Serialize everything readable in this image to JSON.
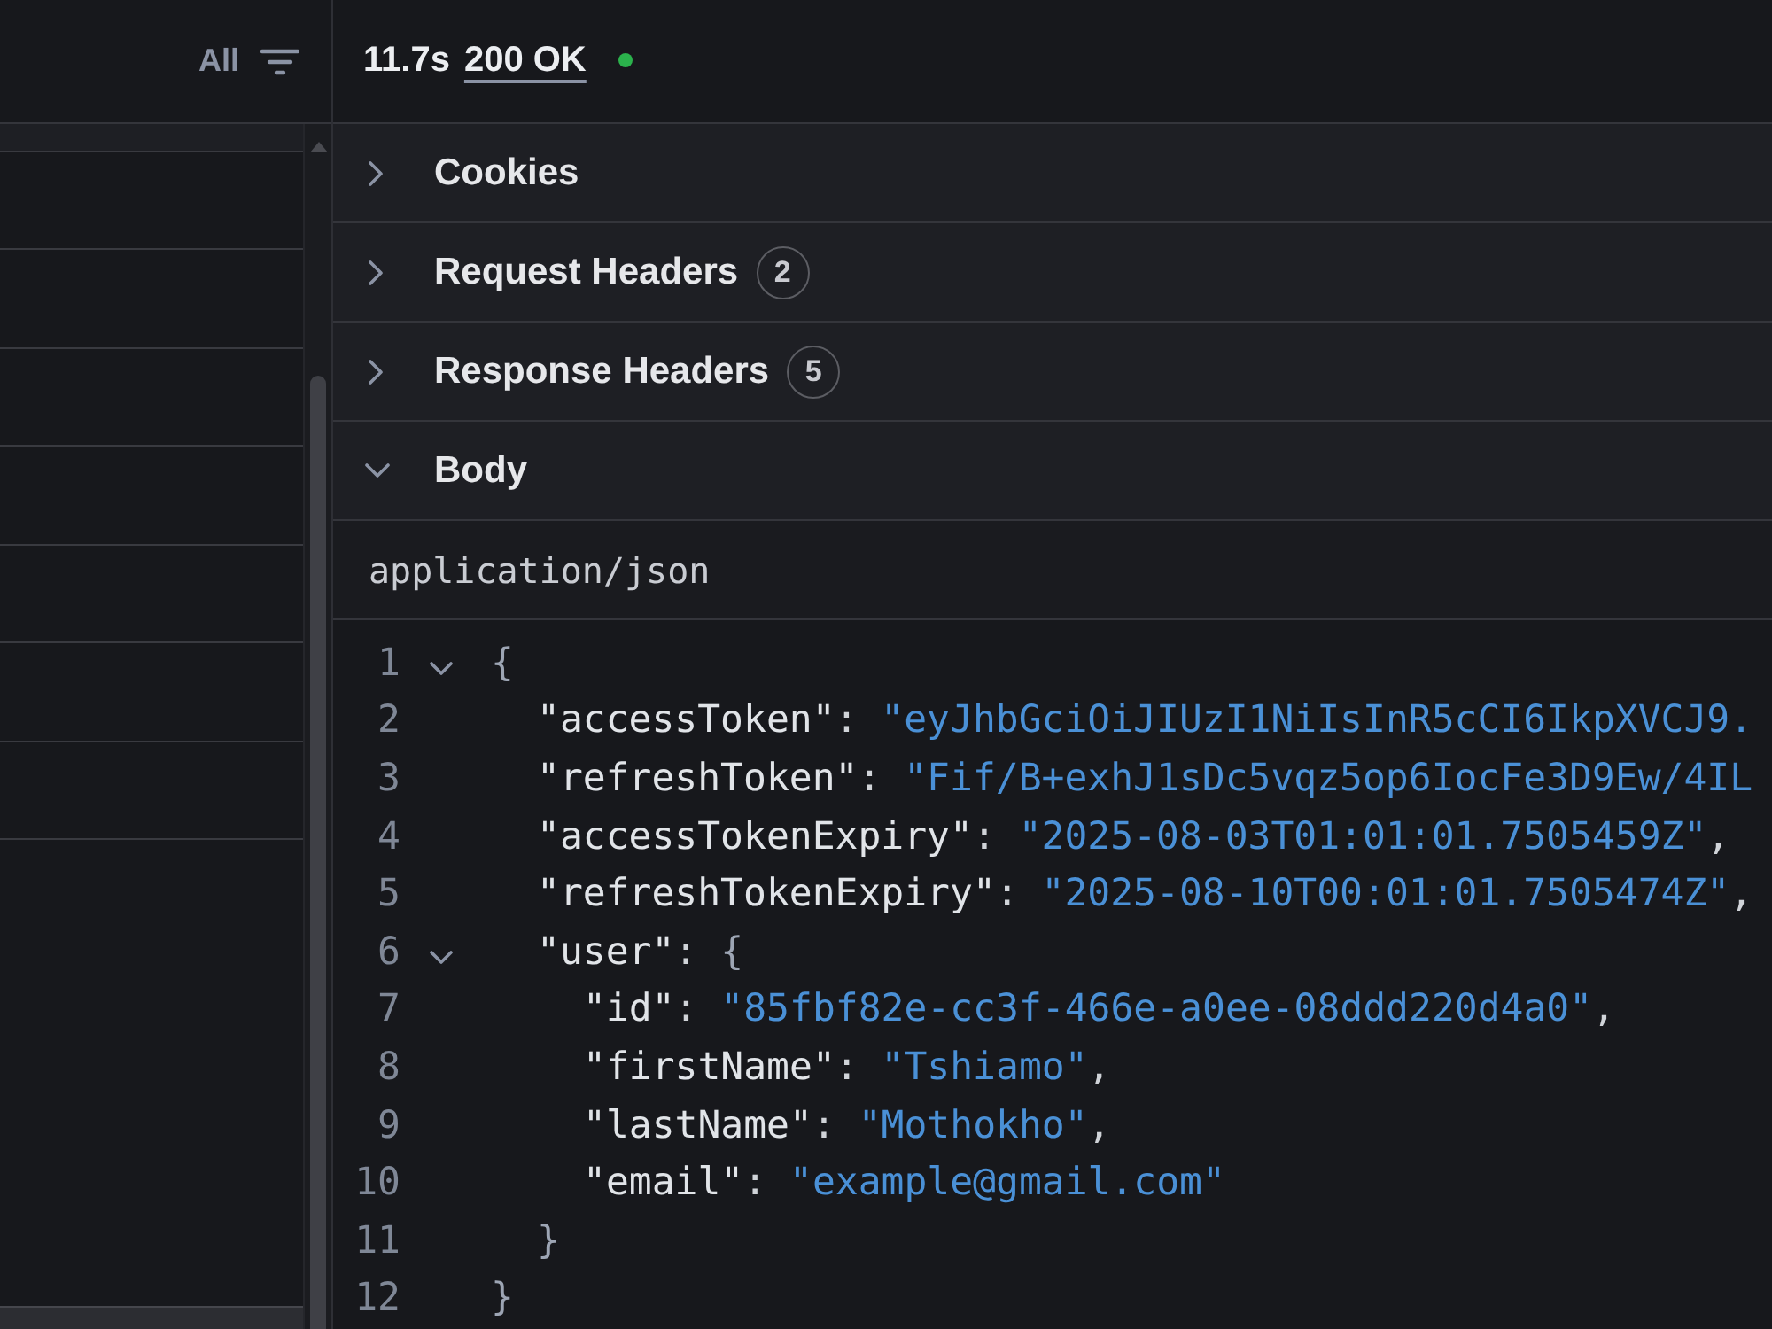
{
  "request_list": {
    "filter": {
      "label": "All"
    }
  },
  "response": {
    "time": "11.7s",
    "status": "200 OK",
    "sections": [
      {
        "title": "Cookies",
        "expanded": false
      },
      {
        "title": "Request Headers",
        "count": "2",
        "expanded": false
      },
      {
        "title": "Response Headers",
        "count": "5",
        "expanded": false
      },
      {
        "title": "Body",
        "expanded": true,
        "content_type": "application/json",
        "lines": [
          {
            "number": "1",
            "expanded": true,
            "tokens": [
              {
                "kind": "brace",
                "text": "{"
              }
            ],
            "children": [
              {
                "number": "2",
                "tokens": [
                  {
                    "kind": "key",
                    "text": "\"accessToken\""
                  },
                  {
                    "kind": "punct",
                    "text": ": "
                  },
                  {
                    "kind": "string",
                    "text": "\"eyJhbGciOiJIUzI1NiIsInR5cCI6IkpXVCJ9."
                  }
                ]
              },
              {
                "number": "3",
                "tokens": [
                  {
                    "kind": "key",
                    "text": "\"refreshToken\""
                  },
                  {
                    "kind": "punct",
                    "text": ": "
                  },
                  {
                    "kind": "string",
                    "text": "\"Fif/B+exhJ1sDc5vqz5op6IocFe3D9Ew/4IL"
                  }
                ]
              },
              {
                "number": "4",
                "tokens": [
                  {
                    "kind": "key",
                    "text": "\"accessTokenExpiry\""
                  },
                  {
                    "kind": "punct",
                    "text": ": "
                  },
                  {
                    "kind": "string",
                    "text": "\"2025-08-03T01:01:01.7505459Z\""
                  },
                  {
                    "kind": "punct",
                    "text": ","
                  }
                ]
              },
              {
                "number": "5",
                "tokens": [
                  {
                    "kind": "key",
                    "text": "\"refreshTokenExpiry\""
                  },
                  {
                    "kind": "punct",
                    "text": ": "
                  },
                  {
                    "kind": "string",
                    "text": "\"2025-08-10T00:01:01.7505474Z\""
                  },
                  {
                    "kind": "punct",
                    "text": ","
                  }
                ]
              },
              {
                "number": "6",
                "expanded": true,
                "tokens": [
                  {
                    "kind": "key",
                    "text": "\"user\""
                  },
                  {
                    "kind": "punct",
                    "text": ": "
                  },
                  {
                    "kind": "brace",
                    "text": "{"
                  }
                ],
                "children": [
                  {
                    "number": "7",
                    "tokens": [
                      {
                        "kind": "key",
                        "text": "\"id\""
                      },
                      {
                        "kind": "punct",
                        "text": ": "
                      },
                      {
                        "kind": "string",
                        "text": "\"85fbf82e-cc3f-466e-a0ee-08ddd220d4a0\""
                      },
                      {
                        "kind": "punct",
                        "text": ","
                      }
                    ]
                  },
                  {
                    "number": "8",
                    "tokens": [
                      {
                        "kind": "key",
                        "text": "\"firstName\""
                      },
                      {
                        "kind": "punct",
                        "text": ": "
                      },
                      {
                        "kind": "string",
                        "text": "\"Tshiamo\""
                      },
                      {
                        "kind": "punct",
                        "text": ","
                      }
                    ]
                  },
                  {
                    "number": "9",
                    "tokens": [
                      {
                        "kind": "key",
                        "text": "\"lastName\""
                      },
                      {
                        "kind": "punct",
                        "text": ": "
                      },
                      {
                        "kind": "string",
                        "text": "\"Mothokho\""
                      },
                      {
                        "kind": "punct",
                        "text": ","
                      }
                    ]
                  },
                  {
                    "number": "10",
                    "tokens": [
                      {
                        "kind": "key",
                        "text": "\"email\""
                      },
                      {
                        "kind": "punct",
                        "text": ": "
                      },
                      {
                        "kind": "string",
                        "text": "\"example@gmail.com\""
                      }
                    ]
                  }
                ]
              },
              {
                "number": "11",
                "tokens": [
                  {
                    "kind": "brace",
                    "text": "}"
                  }
                ]
              }
            ]
          },
          {
            "number": "12",
            "tokens": [
              {
                "kind": "brace",
                "text": "}"
              }
            ]
          }
        ]
      }
    ]
  }
}
